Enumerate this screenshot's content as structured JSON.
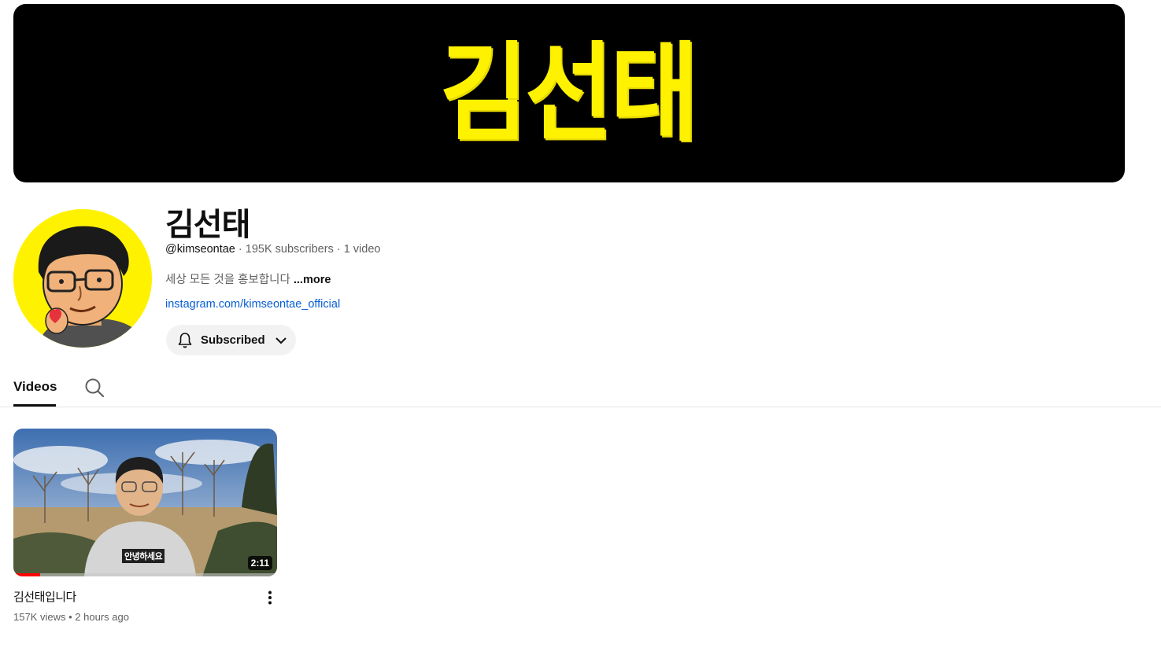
{
  "banner": {
    "logo_text": "김선태",
    "background": "#000000",
    "logo_color": "#fff200"
  },
  "channel": {
    "name": "김선태",
    "handle": "@kimseontae",
    "subscribers": "195K subscribers",
    "video_count": "1 video",
    "separator": "·",
    "description": "세상 모든 것을 홍보합니다",
    "more_label": "...more",
    "link_text": "instagram.com/kimseontae_official",
    "avatar_icon": "avatar-illustration"
  },
  "subscribe": {
    "label": "Subscribed",
    "icon": "bell-icon",
    "dropdown_icon": "chevron-down-icon"
  },
  "tabs": {
    "items": [
      {
        "label": "Videos",
        "active": true
      }
    ],
    "search_icon": "search-icon"
  },
  "video": {
    "title": "김선태입니다",
    "caption": "안녕하세요",
    "duration": "2:11",
    "views": "157K views",
    "dot": "•",
    "age": "2 hours ago",
    "watched_progress": 0.1,
    "menu_icon": "more-vert-icon"
  },
  "colors": {
    "link": "#065fd4",
    "progress": "#ff0000",
    "button_bg": "#f2f2f2",
    "secondary_text": "#606060"
  }
}
